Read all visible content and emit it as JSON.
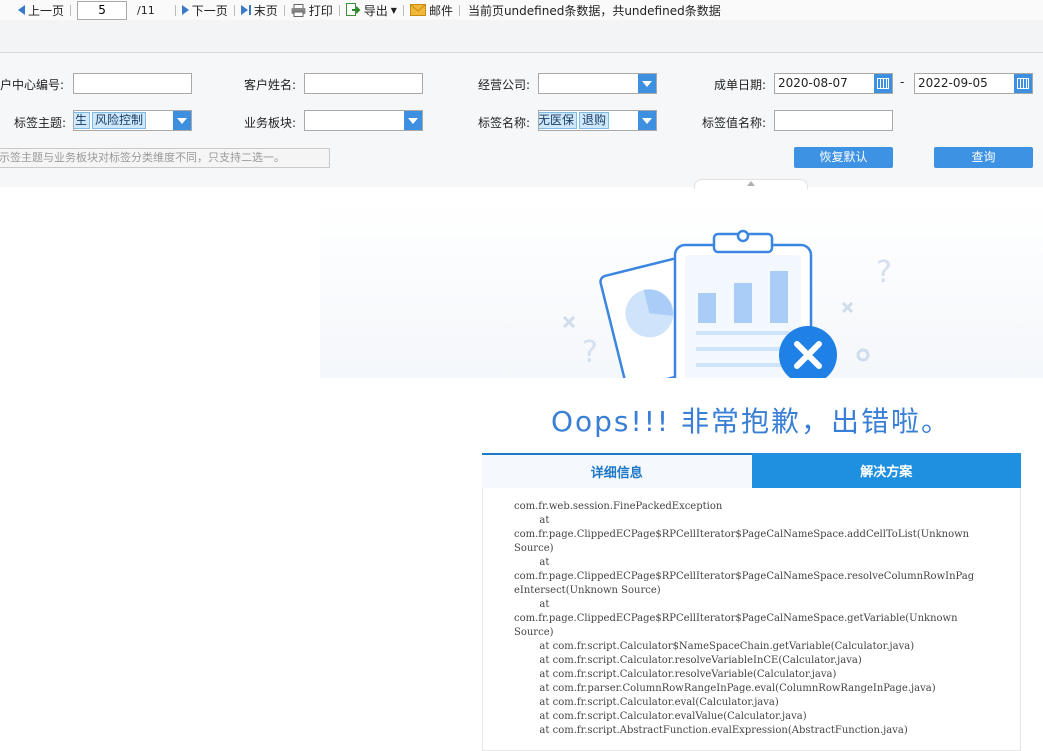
{
  "toolbar": {
    "prev_label": "上一页",
    "page_value": "5",
    "page_total": "/11",
    "next_label": "下一页",
    "last_label": "末页",
    "print_label": "打印",
    "export_label": "导出",
    "mail_label": "邮件",
    "status": "当前页undefined条数据，共undefined条数据"
  },
  "filters": {
    "customer_center_id_label": "户中心编号:",
    "customer_name_label": "客户姓名:",
    "company_label": "经营公司:",
    "order_date_label": "成单日期:",
    "date_from": "2020-08-07",
    "date_sep": "-",
    "date_to": "2022-09-05",
    "tag_topic_label": "标签主题:",
    "tag_topic_tags": [
      "生",
      "风险控制"
    ],
    "business_block_label": "业务板块:",
    "tag_name_label": "标签名称:",
    "tag_name_tags": [
      "无医保",
      "退购"
    ],
    "tag_value_label": "标签值名称:",
    "hint": "示签主题与业务板块对标签分类维度不同，只支持二选一。",
    "reset_label": "恢复默认",
    "query_label": "查询"
  },
  "error": {
    "title": "Oops!!! 非常抱歉，出错啦。",
    "tab_detail": "详细信息",
    "tab_solution": "解决方案",
    "stack_lines": [
      "com.fr.web.session.FinePackedException",
      "        at",
      "com.fr.page.ClippedECPage$RPCellIterator$PageCalNameSpace.addCellToList(Unknown",
      "Source)",
      "        at",
      "com.fr.page.ClippedECPage$RPCellIterator$PageCalNameSpace.resolveColumnRowInPag",
      "eIntersect(Unknown Source)",
      "        at",
      "com.fr.page.ClippedECPage$RPCellIterator$PageCalNameSpace.getVariable(Unknown",
      "Source)",
      "        at com.fr.script.Calculator$NameSpaceChain.getVariable(Calculator.java)",
      "        at com.fr.script.Calculator.resolveVariableInCE(Calculator.java)",
      "        at com.fr.script.Calculator.resolveVariable(Calculator.java)",
      "        at com.fr.parser.ColumnRowRangeInPage.eval(ColumnRowRangeInPage.java)",
      "        at com.fr.script.Calculator.eval(Calculator.java)",
      "        at com.fr.script.Calculator.evalValue(Calculator.java)",
      "        at com.fr.script.AbstractFunction.evalExpression(AbstractFunction.java)"
    ]
  }
}
